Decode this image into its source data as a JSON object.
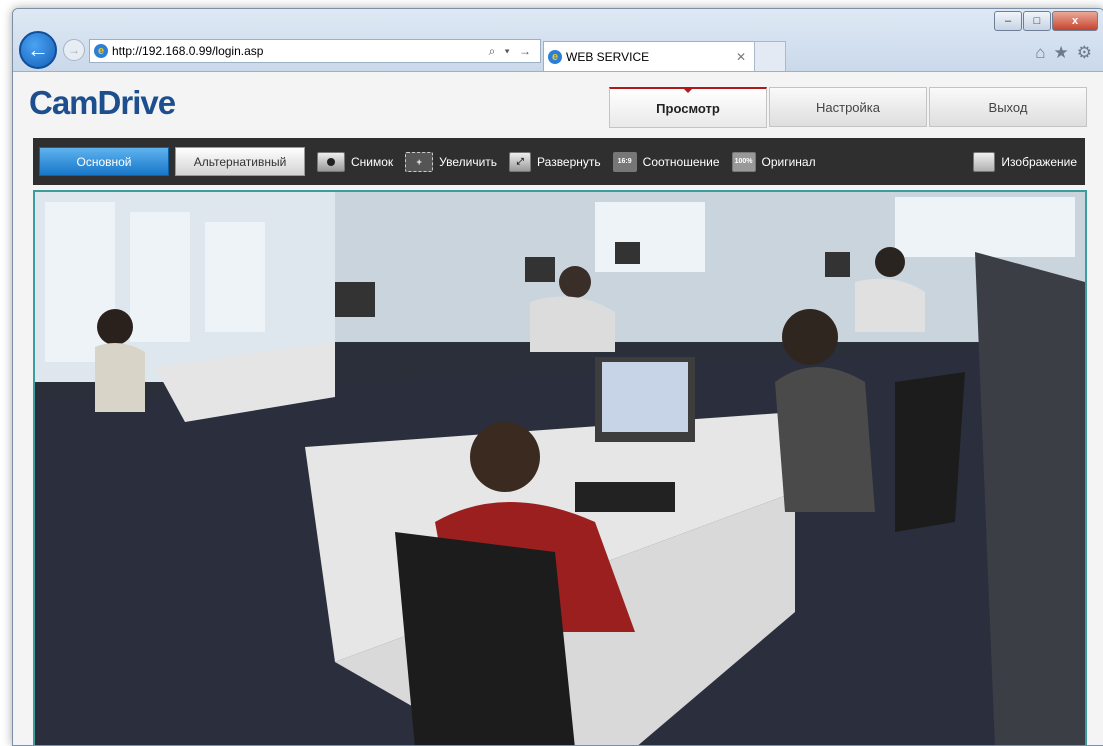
{
  "browser": {
    "address_url": "http://192.168.0.99/login.asp",
    "address_icons": "⌕ ▾ →",
    "tab_title": "WEB SERVICE",
    "window_controls": [
      "–",
      "□",
      "x"
    ]
  },
  "app": {
    "logo": "CamDrive",
    "nav_tabs": [
      {
        "label": "Просмотр",
        "active": true
      },
      {
        "label": "Настройка",
        "active": false
      },
      {
        "label": "Выход",
        "active": false
      }
    ]
  },
  "toolbar": {
    "stream_main": "Основной",
    "stream_alt": "Альтернативный",
    "snapshot": "Снимок",
    "zoom": "Увеличить",
    "expand": "Развернуть",
    "ratio": "Соотношение",
    "ratio_icon": "16:9",
    "original": "Оригинал",
    "original_icon": "100%",
    "image": "Изображение"
  },
  "colors": {
    "logo": "#1d4f8f",
    "toolbar_bg": "#2f2f2f",
    "active_stream": "#1877c9",
    "active_tab_accent": "#b21818",
    "video_border": "#3a9e9e"
  }
}
